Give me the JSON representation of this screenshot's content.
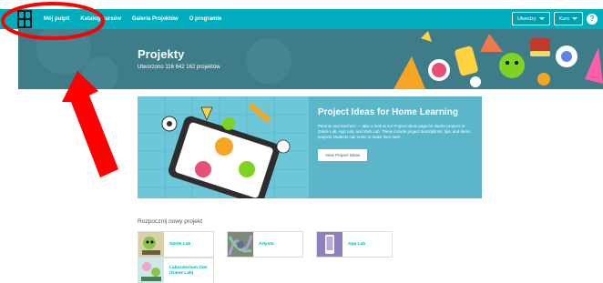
{
  "nav": {
    "links": [
      "Mój pulpit",
      "Katalog kursów",
      "Galeria Projektów",
      "O programie"
    ],
    "dropdown_1": "Ułwedzy",
    "dropdown_2": "Kurs",
    "help": "?"
  },
  "hero": {
    "title": "Projekty",
    "subtitle": "Utworzono 116 642 162 projektów"
  },
  "feature": {
    "title": "Project Ideas for Home Learning",
    "body": "Parents and teachers — take a look at our Project Ideas page for starter projects in Game Lab, App Lab, and Web Lab. These include project descriptions, tips, and demo projects students can remix to make their own!",
    "button": "View Project Ideas"
  },
  "start": {
    "label": "Rozpocznij nowy projekt",
    "tiles": [
      "Sprite Lab",
      "Artysta",
      "App Lab",
      "Laboratorium Gier (Game Lab)"
    ]
  },
  "colors": {
    "nav": "#00adbc",
    "hero": "#3f7c89",
    "feature": "#5bb6c9",
    "annotation": "#ff0000"
  }
}
